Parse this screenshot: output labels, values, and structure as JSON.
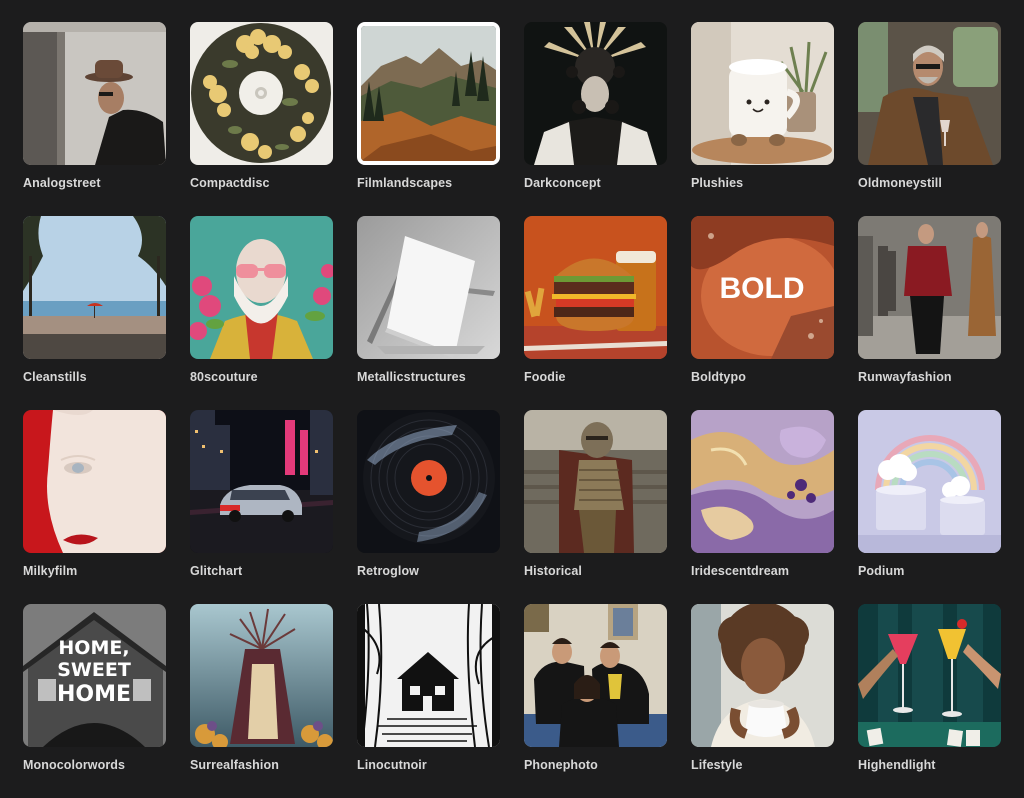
{
  "presets": [
    {
      "label": "Analogstreet",
      "image": "man-in-hat-street-photo"
    },
    {
      "label": "Compactdisc",
      "image": "floral-compact-disc"
    },
    {
      "label": "Filmlandscapes",
      "image": "mountain-forest-landscape",
      "selected": true
    },
    {
      "label": "Darkconcept",
      "image": "dark-feathered-mask-portrait"
    },
    {
      "label": "Plushies",
      "image": "plush-mug-toy"
    },
    {
      "label": "Oldmoneystill",
      "image": "man-in-car-with-wine"
    },
    {
      "label": "Cleanstills",
      "image": "beach-umbrella-trees"
    },
    {
      "label": "80scouture",
      "image": "bearded-man-sunglasses-flowers"
    },
    {
      "label": "Metallicstructures",
      "image": "white-card-metal-stand"
    },
    {
      "label": "Foodie",
      "image": "burger-and-beer"
    },
    {
      "label": "Boldtypo",
      "image": "bold-text-terracotta",
      "text": "BOLD"
    },
    {
      "label": "Runwayfashion",
      "image": "runway-model-red-jacket"
    },
    {
      "label": "Milkyfilm",
      "image": "pale-face-red-lips"
    },
    {
      "label": "Glitchart",
      "image": "night-city-car-neon"
    },
    {
      "label": "Retroglow",
      "image": "vinyl-record"
    },
    {
      "label": "Historical",
      "image": "armored-gladiator"
    },
    {
      "label": "Iridescentdream",
      "image": "iridescent-marble-swirl"
    },
    {
      "label": "Podium",
      "image": "rainbow-clouds-podium"
    },
    {
      "label": "Monocolorwords",
      "image": "home-sweet-home-house",
      "text": [
        "HOME,",
        "SWEET",
        "HOME"
      ]
    },
    {
      "label": "Surrealfashion",
      "image": "cloaked-figure-branches"
    },
    {
      "label": "Linocutnoir",
      "image": "linocut-cabin-woods"
    },
    {
      "label": "Phonephoto",
      "image": "friends-group-photo"
    },
    {
      "label": "Lifestyle",
      "image": "woman-drinking-tea"
    },
    {
      "label": "Highendlight",
      "image": "cocktail-glasses-toast"
    }
  ]
}
